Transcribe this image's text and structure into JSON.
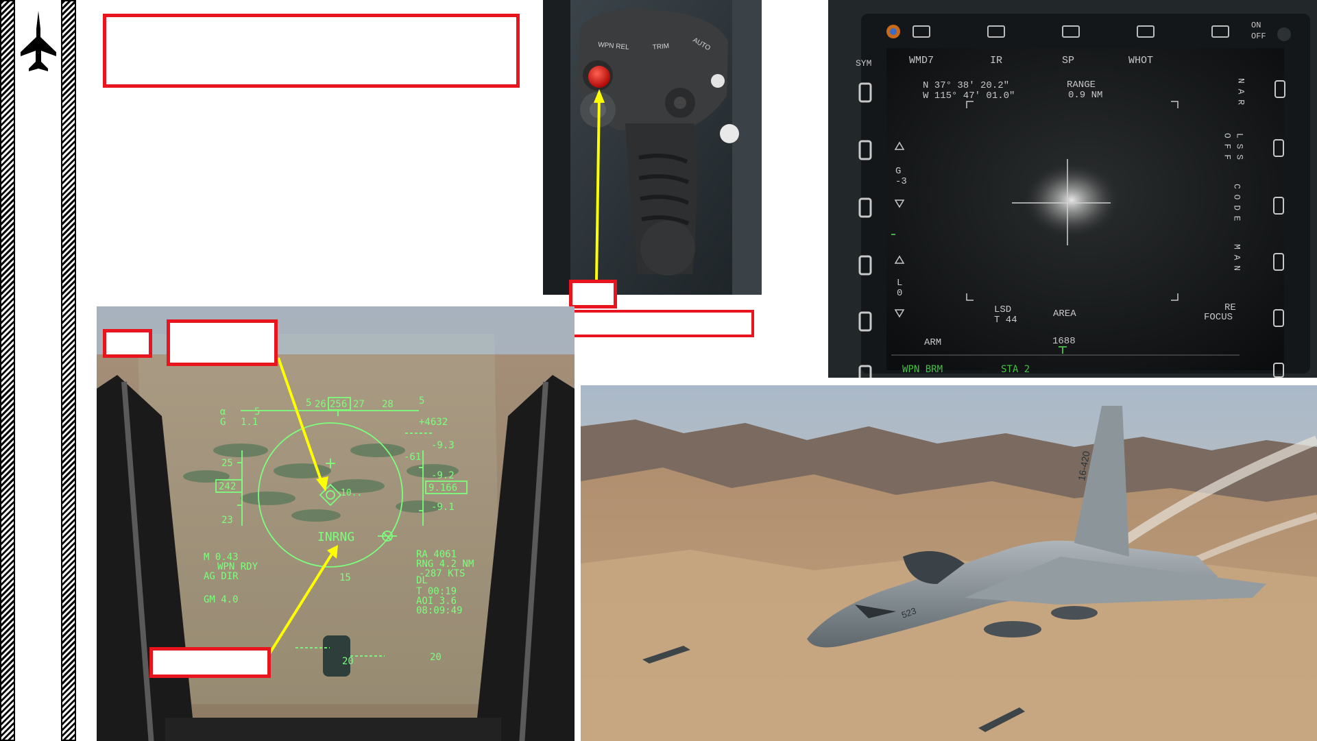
{
  "colors": {
    "callout_red": "#e8141e",
    "hud_green": "#7cff7c",
    "pointer_yellow": "#ffff00"
  },
  "sidebar": {
    "icon": "jet-fighter-icon"
  },
  "hud": {
    "heading_ticks": [
      "5",
      "26",
      "256",
      "27",
      "28",
      "5"
    ],
    "alpha": "α",
    "alpha_val": "5",
    "g_label": "G",
    "g_val": "1.1",
    "speed_ticks": [
      "25",
      "23"
    ],
    "speed_box": "242",
    "alt_top": "+4632",
    "ladder": [
      "-9.3",
      "-61",
      "-9.2",
      "-9.1"
    ],
    "alt_box": "9.166",
    "pipper_label": "10..",
    "inrng": "INRNG",
    "pitch_15": "15",
    "pitch_20": "20",
    "pitch_20b": "20",
    "left_info": [
      "M 0.43",
      "WPN RDY",
      "AG  DIR",
      "GM 4.0"
    ],
    "right_info": [
      "RA  4061",
      "RNG 4.2 NM",
      "-287 KTS",
      "DL",
      "T  00:19",
      "AOI 3.6",
      "08:09:49"
    ]
  },
  "mfd": {
    "sym": "SYM",
    "top_labels": [
      "WMD7",
      "IR",
      "SP",
      "WHOT"
    ],
    "on_off": [
      "ON",
      "OFF"
    ],
    "lat": "N  37° 38' 20.2\"",
    "lon": "W 115° 47' 01.0\"",
    "range_label": "RANGE",
    "range_val": "0.9 NM",
    "g_label": "G",
    "g_val": "-3",
    "l_label": "L",
    "l_val": "0",
    "right_nar": "N A R",
    "right_ls": "L S S",
    "right_off": "O F F",
    "right_code": "C O D E",
    "right_man": "M A N",
    "right_re": "RE",
    "right_focus": "FOCUS",
    "lsd": "LSD",
    "lsd_t": "T 44",
    "area": "AREA",
    "arm": "ARM",
    "num_1688": "1688",
    "status": "WPN  BRM",
    "sta": "STA  2"
  },
  "stick": {
    "wpn_rel": "WPN REL",
    "trim": "TRIM",
    "auto": "AUTO"
  },
  "jet": {
    "tail_code": "16-420",
    "nose_code": "523"
  }
}
